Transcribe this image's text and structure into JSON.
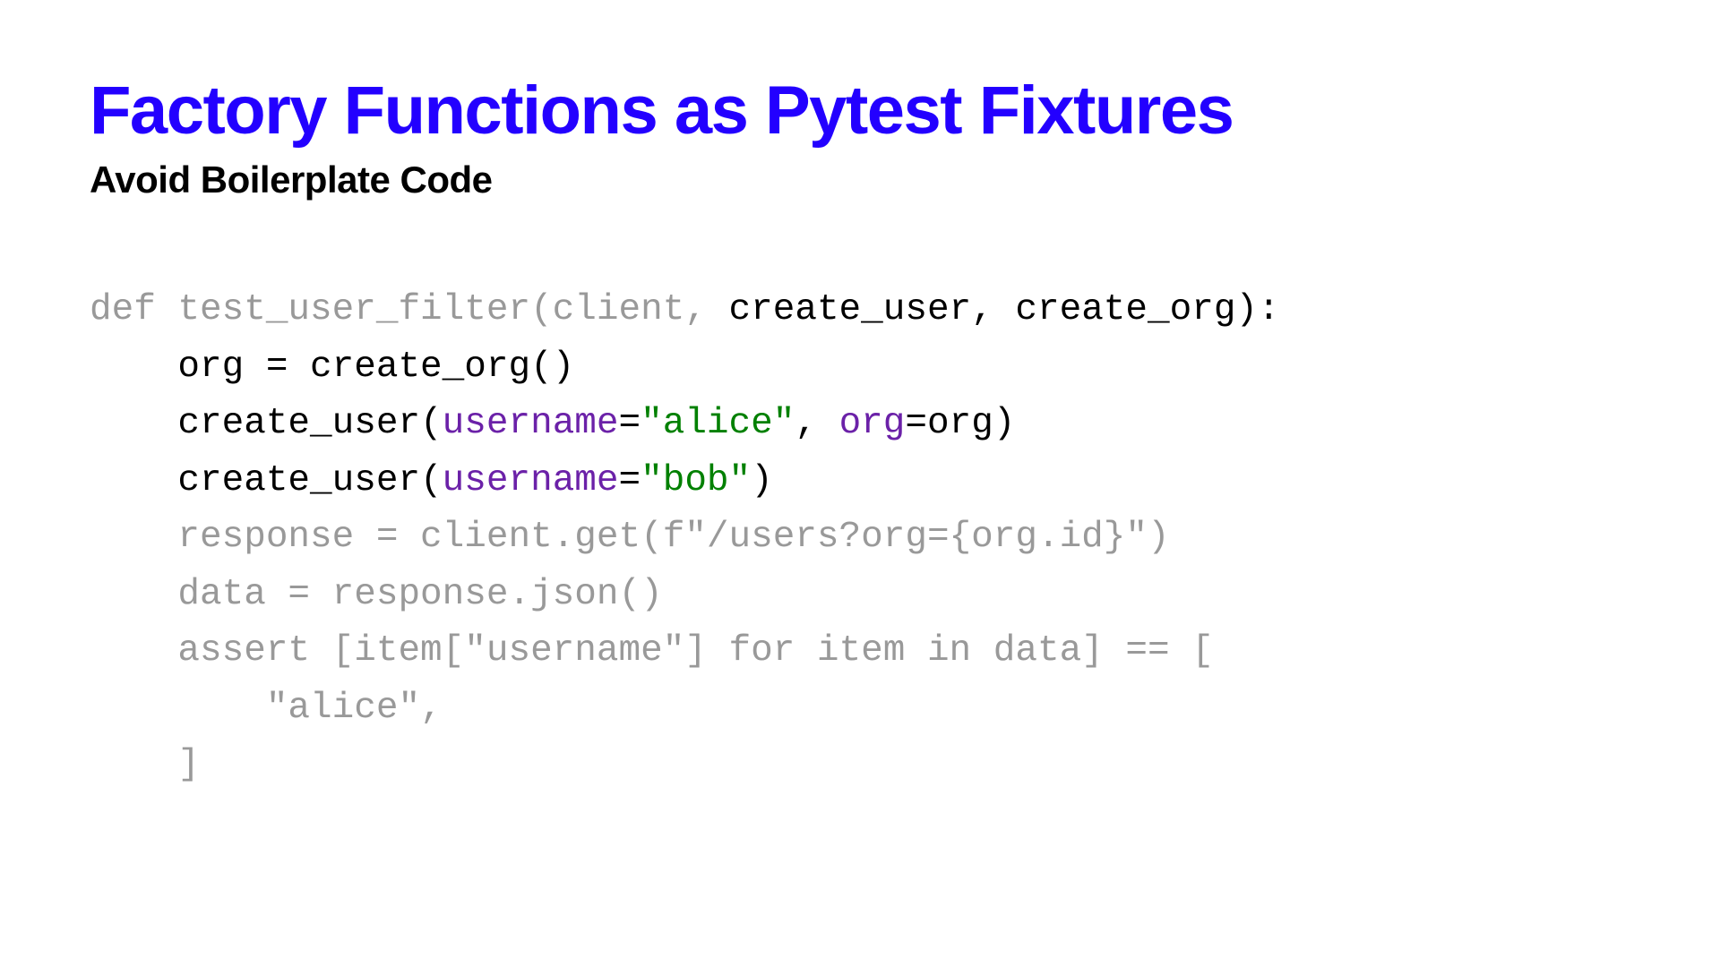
{
  "title": "Factory Functions as Pytest Fixtures",
  "subtitle": "Avoid Boilerplate Code",
  "code": {
    "line1_def": "def test_user_filter(client, ",
    "line1_params": "create_user, create_org):",
    "line2": "    org = create_org()",
    "line3_prefix": "    create_user(",
    "line3_kwarg1": "username",
    "line3_eq1": "=",
    "line3_str1": "\"alice\"",
    "line3_mid": ", ",
    "line3_kwarg2": "org",
    "line3_eq2": "=org)",
    "line4_prefix": "    create_user(",
    "line4_kwarg": "username",
    "line4_eq": "=",
    "line4_str": "\"bob\"",
    "line4_suffix": ")",
    "line5": "    response = client.get(f\"/users?org={org.id}\")",
    "line6": "    data = response.json()",
    "line7": "    assert [item[\"username\"] for item in data] == [",
    "line8": "        \"alice\",",
    "line9": "    ]"
  }
}
